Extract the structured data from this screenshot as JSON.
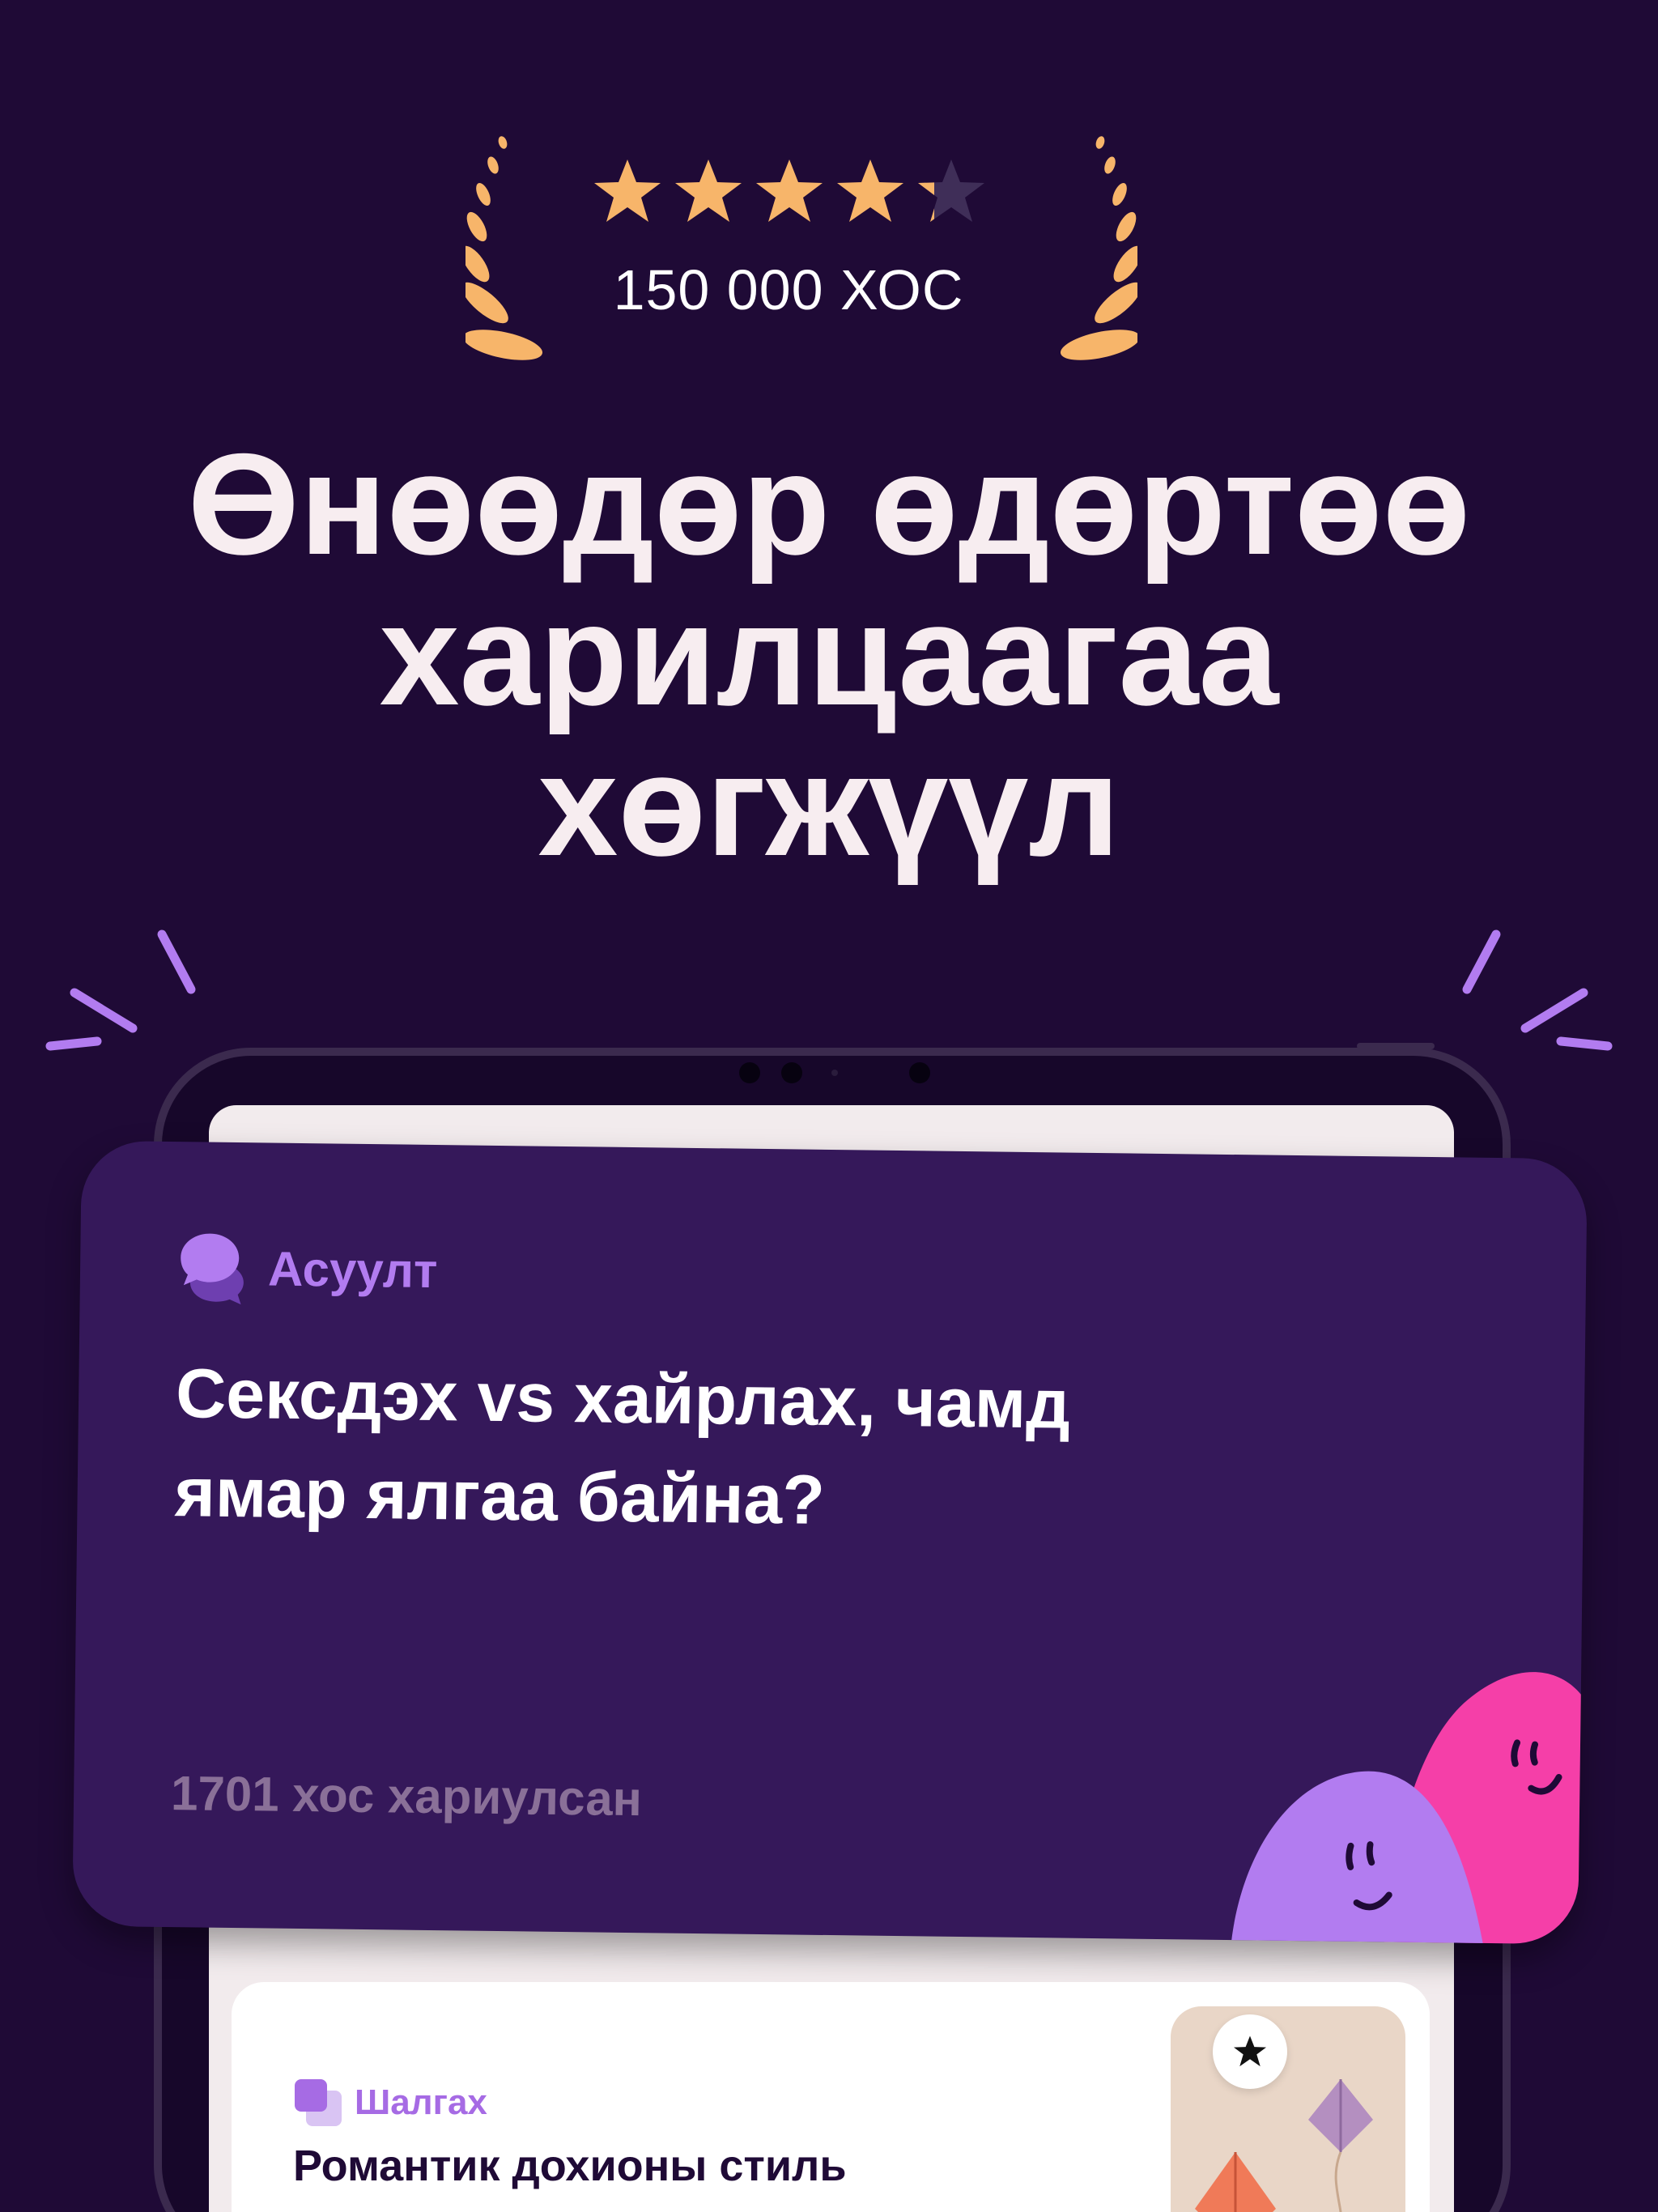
{
  "rating": {
    "stars_value": 4.5,
    "stars_max": 5,
    "caption": "150 000 ХОС"
  },
  "headline": "Өнөөдөр өдөртөө харилцаагаа хөгжүүл",
  "question_card": {
    "tag_label": "Асуулт",
    "question": "Сексдэх vs хайрлах, чамд ямар ялгаа байна?",
    "answer_count": "1701 хос хариулсан"
  },
  "quiz_card": {
    "tag_label": "Шалгах",
    "title": "Романтик дохионы стиль"
  },
  "colors": {
    "background": "#1f0a36",
    "card": "#35185a",
    "accent_purple": "#b27cf0",
    "accent_pink": "#f53fa8",
    "star_gold": "#f7b56a",
    "headline": "#f7edf0"
  },
  "icons": {
    "laurel": "laurel-icon",
    "star": "star-icon",
    "chat": "chat-bubbles-icon",
    "layers": "layers-icon",
    "favorite": "star-icon"
  }
}
